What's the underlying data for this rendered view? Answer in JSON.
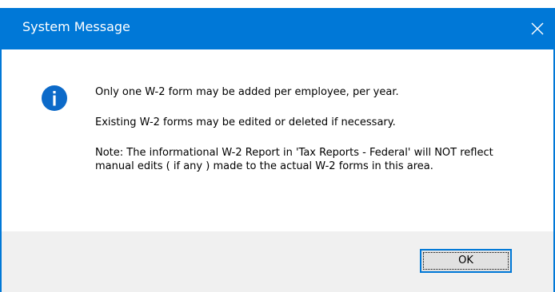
{
  "window": {
    "title": "System Message",
    "accent_color": "#0078d7"
  },
  "icon": {
    "name": "information-icon",
    "color": "#0c6ac9"
  },
  "message": {
    "line1": "Only one W-2 form may be added per employee, per year.",
    "line2": "Existing W-2 forms may be edited or deleted if necessary.",
    "line3": "Note: The informational W-2 Report in 'Tax Reports - Federal' will NOT reflect manual edits ( if any ) made to the actual W-2 forms in this area."
  },
  "buttons": {
    "ok_label": "OK"
  }
}
